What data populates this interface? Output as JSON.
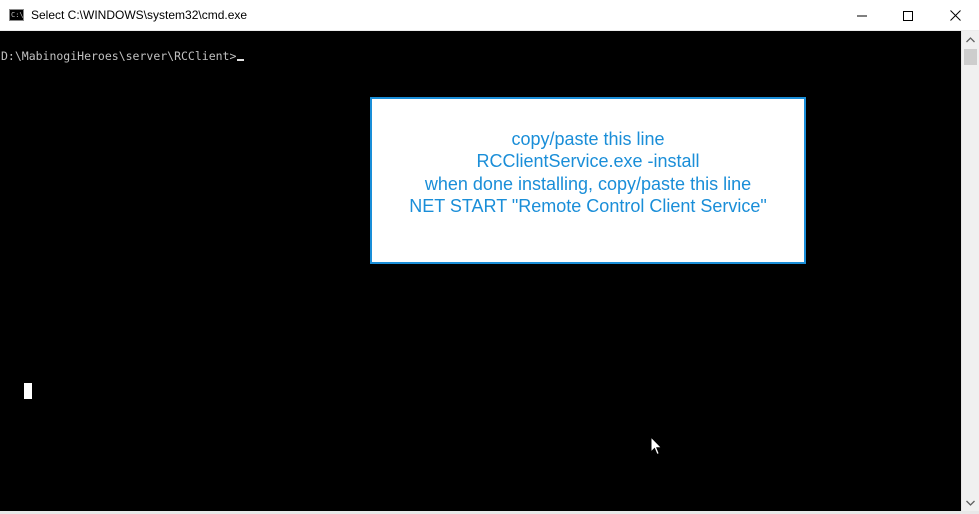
{
  "window": {
    "title": "Select C:\\WINDOWS\\system32\\cmd.exe",
    "icon": "cmd-icon",
    "icon_text": "C:\\",
    "buttons": {
      "minimize": "minimize-icon",
      "maximize": "maximize-icon",
      "close": "close-icon"
    }
  },
  "console": {
    "prompt": "D:\\MabinogiHeroes\\server\\RCClient>",
    "background": "#000000",
    "foreground": "#c0c0c0"
  },
  "note": {
    "lines": [
      "copy/paste this line",
      "RCClientService.exe -install",
      "when done installing, copy/paste this line",
      "NET START \"Remote Control Client Service\""
    ],
    "text_color": "#1a8ed8",
    "border_color": "#1a8ed8"
  },
  "scrollbar": {
    "up": "scroll-up-arrow-icon",
    "down": "scroll-down-arrow-icon"
  }
}
